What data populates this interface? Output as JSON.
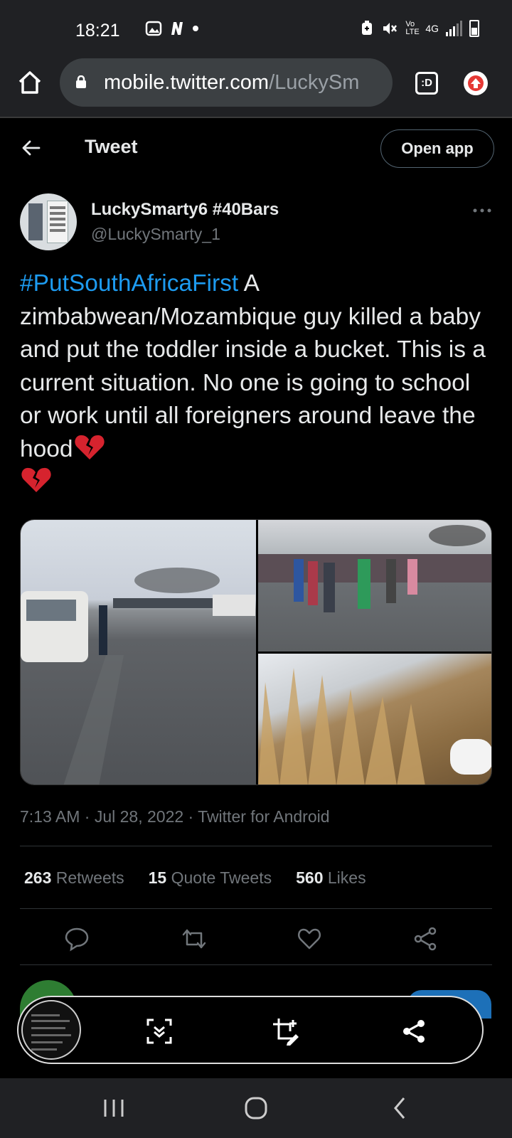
{
  "status_bar": {
    "time": "18:21",
    "network": "4G",
    "volte": "Vo LTE"
  },
  "browser": {
    "url_host": "mobile.twitter.com",
    "url_path": "/LuckySm",
    "tab_count": ":D"
  },
  "header": {
    "title": "Tweet",
    "open_app_label": "Open app"
  },
  "tweet": {
    "display_name": "LuckySmarty6 #40Bars",
    "handle": "@LuckySmarty_1",
    "hashtag": "#PutSouthAfricaFirst",
    "body": " A zimbabwean/Mozambique guy killed a baby and put the toddler inside a bucket. This is a current situation. No one is going to school or work until all foreigners around leave the hood",
    "emoji": "broken-heart",
    "meta": "7:13 AM · Jul 28, 2022 · Twitter for Android",
    "stats": {
      "retweets_count": "263",
      "retweets_label": "Retweets",
      "quotes_count": "15",
      "quotes_label": "Quote Tweets",
      "likes_count": "560",
      "likes_label": "Likes"
    },
    "images": [
      "road-crowd-photo",
      "crowd-gathering-photo",
      "dry-grass-roadside-photo"
    ]
  },
  "colors": {
    "hashtag": "#1d9bf0",
    "muted": "#71767b",
    "text": "#e7e9ea",
    "background": "#000000"
  }
}
